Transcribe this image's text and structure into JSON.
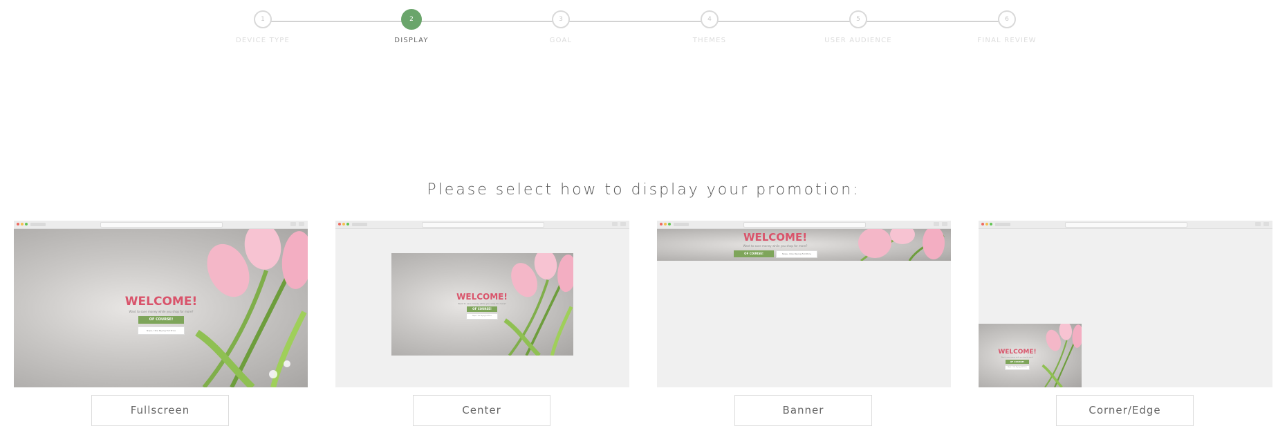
{
  "stepper": {
    "steps": [
      {
        "number": "1",
        "label": "DEVICE TYPE"
      },
      {
        "number": "2",
        "label": "DISPLAY"
      },
      {
        "number": "3",
        "label": "GOAL"
      },
      {
        "number": "4",
        "label": "THEMES"
      },
      {
        "number": "5",
        "label": "USER AUDIENCE"
      },
      {
        "number": "6",
        "label": "FINAL REVIEW"
      }
    ],
    "active_step": 2,
    "accent_color": "#6aa56b"
  },
  "prompt": "Please select how to display your promotion:",
  "preview": {
    "headline": "WELCOME!",
    "subtext": "Want to save money while you shop for more?",
    "accept_label": "OF COURSE!",
    "decline_label": "Nope, I like Paying Full Price",
    "headline_color": "#d9546b",
    "accept_color": "#7ea55a"
  },
  "options": [
    {
      "label": "Fullscreen"
    },
    {
      "label": "Center"
    },
    {
      "label": "Banner"
    },
    {
      "label": "Corner/Edge"
    }
  ]
}
